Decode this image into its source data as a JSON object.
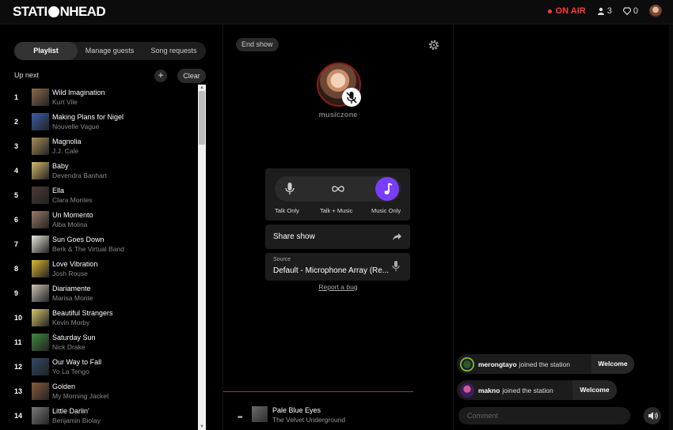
{
  "app": {
    "logo_pre": "STATI",
    "logo_post": "NHEAD"
  },
  "topbar": {
    "on_air": "ON AIR",
    "listeners": "3",
    "diamonds": "0"
  },
  "left": {
    "tabs": [
      "Playlist",
      "Manage guests",
      "Song requests"
    ],
    "up_next": "Up next",
    "add": "+",
    "clear": "Clear",
    "songs": [
      {
        "n": "1",
        "title": "Wild Imagination",
        "artist": "Kurt Vile",
        "art": "#8a6a4a"
      },
      {
        "n": "2",
        "title": "Making Plans for Nigel",
        "artist": "Nouvelle Vague",
        "art": "#3b5da8"
      },
      {
        "n": "3",
        "title": "Magnolia",
        "artist": "J.J. Cale",
        "art": "#a88d55"
      },
      {
        "n": "4",
        "title": "Baby",
        "artist": "Devendra Banhart",
        "art": "#d8b86a"
      },
      {
        "n": "5",
        "title": "Ella",
        "artist": "Clara Montes",
        "art": "#4a3a36"
      },
      {
        "n": "6",
        "title": "Un Momento",
        "artist": "Alba Molina",
        "art": "#9a7a68"
      },
      {
        "n": "7",
        "title": "Sun Goes Down",
        "artist": "Berk & The Virtual Band",
        "art": "#e9e6dc"
      },
      {
        "n": "8",
        "title": "Love Vibration",
        "artist": "Josh Rouse",
        "art": "#e0b830"
      },
      {
        "n": "9",
        "title": "Diariamente",
        "artist": "Marisa Monte",
        "art": "#c9c2b4"
      },
      {
        "n": "10",
        "title": "Beautiful Strangers",
        "artist": "Kevin Morby",
        "art": "#d6c56a"
      },
      {
        "n": "11",
        "title": "Saturday Sun",
        "artist": "Nick Drake",
        "art": "#3f8a3a"
      },
      {
        "n": "12",
        "title": "Our Way to Fall",
        "artist": "Yo La Tengo",
        "art": "#2f4a6a"
      },
      {
        "n": "13",
        "title": "Golden",
        "artist": "My Morning Jacket",
        "art": "#8a5a3a"
      },
      {
        "n": "14",
        "title": "Little Darlin'",
        "artist": "Benjamin Biolay",
        "art": "#7a7a7a"
      }
    ]
  },
  "center": {
    "end_show": "End show",
    "host_name": "musiczone",
    "modes": [
      "Talk Only",
      "Talk + Music",
      "Music Only"
    ],
    "share": "Share show",
    "source_caption": "Source",
    "source_value": "Default - Microphone Array (Re...",
    "report": "Report a bug",
    "now_playing": {
      "eq": "▪▪▪",
      "title": "Pale Blue Eyes",
      "artist": "The Velvet Underground"
    }
  },
  "right": {
    "joins": [
      {
        "user": "merongtayo",
        "text": "joined the station",
        "button": "Welcome"
      },
      {
        "user": "makno",
        "text": "joined the station",
        "button": "Welcome"
      }
    ],
    "comment_placeholder": "Comment"
  },
  "colors": {
    "accent": "#7a3cff",
    "on_air": "#ff3b3b",
    "progress": "#c0272d"
  }
}
